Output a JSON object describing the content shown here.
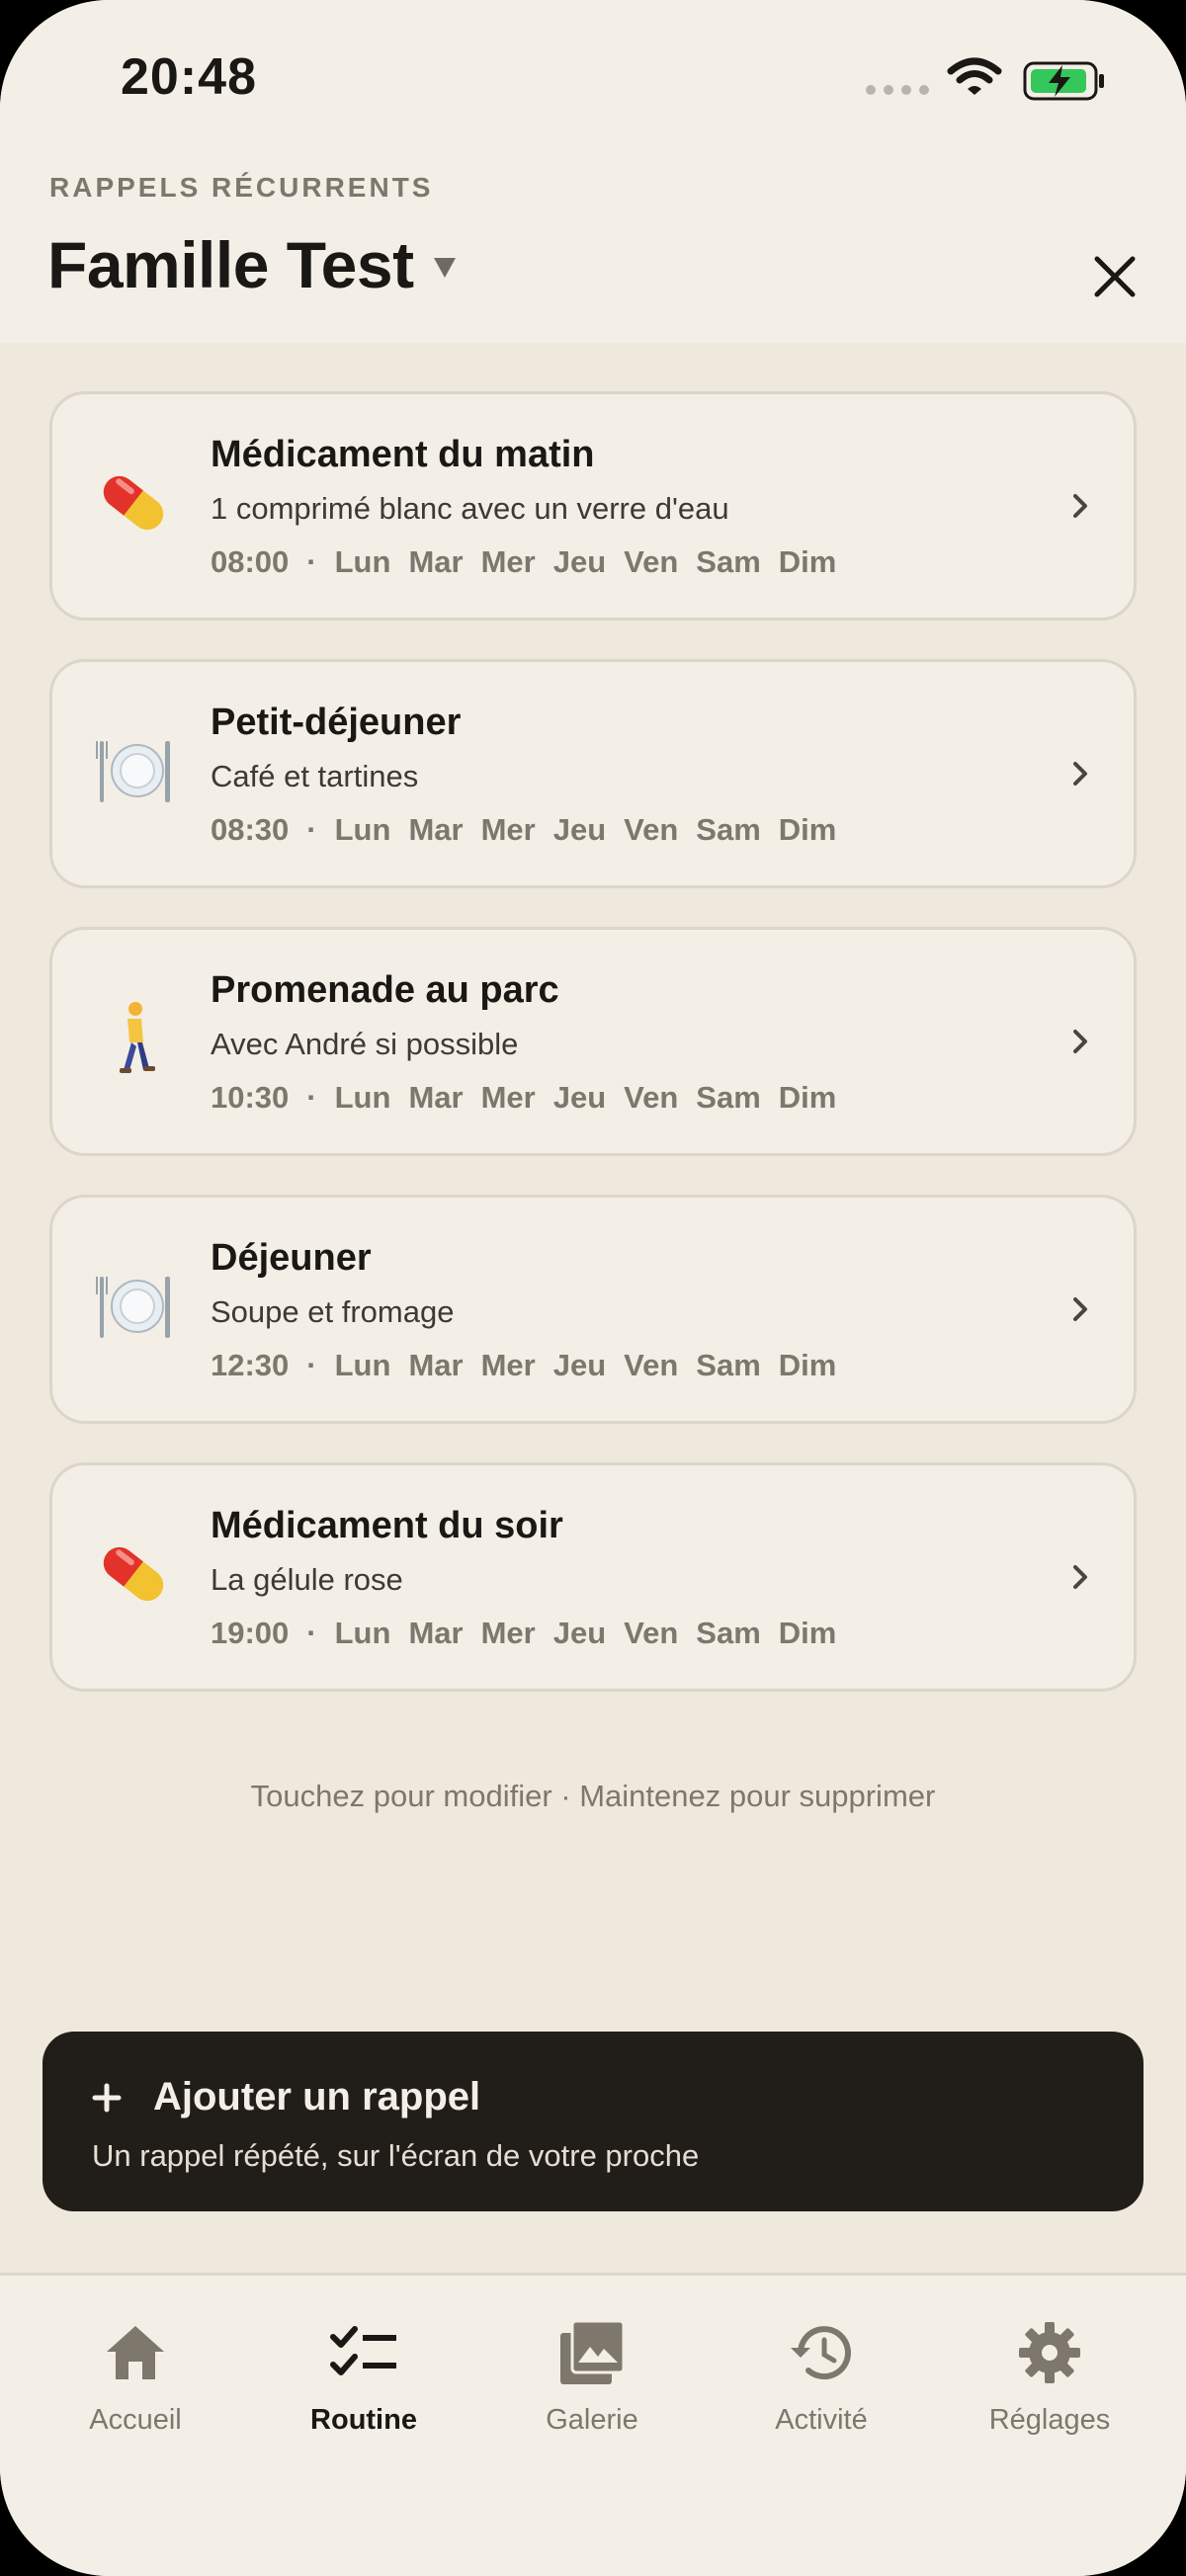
{
  "status_bar": {
    "time": "20:48"
  },
  "header": {
    "eyebrow": "RAPPELS RÉCURRENTS",
    "title": "Famille Test"
  },
  "reminders": [
    {
      "icon": "pill-icon",
      "title": "Médicament du matin",
      "subtitle": "1 comprimé blanc avec un verre d'eau",
      "time": "08:00",
      "days": [
        "Lun",
        "Mar",
        "Mer",
        "Jeu",
        "Ven",
        "Sam",
        "Dim"
      ]
    },
    {
      "icon": "plate-icon",
      "title": "Petit-déjeuner",
      "subtitle": "Café et tartines",
      "time": "08:30",
      "days": [
        "Lun",
        "Mar",
        "Mer",
        "Jeu",
        "Ven",
        "Sam",
        "Dim"
      ]
    },
    {
      "icon": "walking-person-icon",
      "title": "Promenade au parc",
      "subtitle": "Avec André si possible",
      "time": "10:30",
      "days": [
        "Lun",
        "Mar",
        "Mer",
        "Jeu",
        "Ven",
        "Sam",
        "Dim"
      ]
    },
    {
      "icon": "plate-icon",
      "title": "Déjeuner",
      "subtitle": "Soupe et fromage",
      "time": "12:30",
      "days": [
        "Lun",
        "Mar",
        "Mer",
        "Jeu",
        "Ven",
        "Sam",
        "Dim"
      ]
    },
    {
      "icon": "pill-icon",
      "title": "Médicament du soir",
      "subtitle": "La gélule rose",
      "time": "19:00",
      "days": [
        "Lun",
        "Mar",
        "Mer",
        "Jeu",
        "Ven",
        "Sam",
        "Dim"
      ]
    }
  ],
  "hint": "Touchez pour modifier · Maintenez pour supprimer",
  "add_button": {
    "label": "Ajouter un rappel",
    "sublabel": "Un rappel répété, sur l'écran de votre proche"
  },
  "tabs": [
    {
      "icon": "home-icon",
      "label": "Accueil",
      "active": false
    },
    {
      "icon": "checklist-icon",
      "label": "Routine",
      "active": true
    },
    {
      "icon": "gallery-icon",
      "label": "Galerie",
      "active": false
    },
    {
      "icon": "history-icon",
      "label": "Activité",
      "active": false
    },
    {
      "icon": "gear-icon",
      "label": "Réglages",
      "active": false
    }
  ],
  "colors": {
    "background": "#efe8dd",
    "surface": "#f3efe6",
    "border": "#dcd5c9",
    "text_primary": "#1a1815",
    "text_muted": "#7d776c",
    "button_dark": "#211e1a",
    "battery_green": "#34c759"
  }
}
